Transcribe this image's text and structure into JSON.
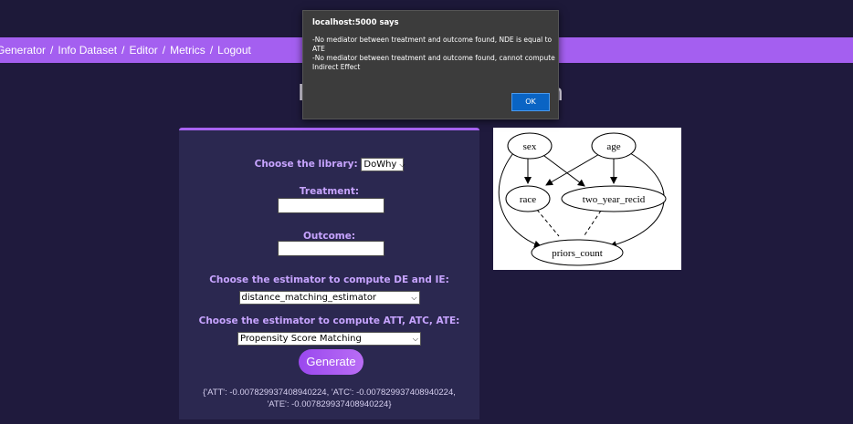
{
  "nav": {
    "items": [
      "Generator",
      "Info Dataset",
      "Editor",
      "Metrics",
      "Logout"
    ],
    "separator": "/"
  },
  "title": {
    "left_fragment": "I",
    "right_fragment": "n"
  },
  "form": {
    "library_label": "Choose the library:",
    "library_value": "DoWhy",
    "treatment_label": "Treatment:",
    "treatment_value": "",
    "outcome_label": "Outcome:",
    "outcome_value": "",
    "de_ie_label": "Choose the estimator to compute DE and IE:",
    "de_ie_value": "distance_matching_estimator",
    "att_label": "Choose the estimator to compute ATT, ATC, ATE:",
    "att_value": "Propensity Score Matching",
    "generate_label": "Generate",
    "result_line1": "{'ATT': -0.007829937408940224, 'ATC': -0.007829937408940224,",
    "result_line2": "'ATE': -0.007829937408940224}"
  },
  "graph": {
    "nodes": [
      "sex",
      "age",
      "race",
      "two_year_recid",
      "priors_count"
    ]
  },
  "alert": {
    "title": "localhost:5000 says",
    "line1": "-No mediator between treatment and outcome found, NDE is equal to ATE",
    "line2": "-No mediator between treatment and outcome found, cannot compute Indirect Effect",
    "ok_label": "OK"
  },
  "colors": {
    "background": "#1f1a3d",
    "nav": "#a45ff0",
    "panel": "#2b2850",
    "accent_label": "#c7a4ff",
    "button": "#a45ff0"
  }
}
